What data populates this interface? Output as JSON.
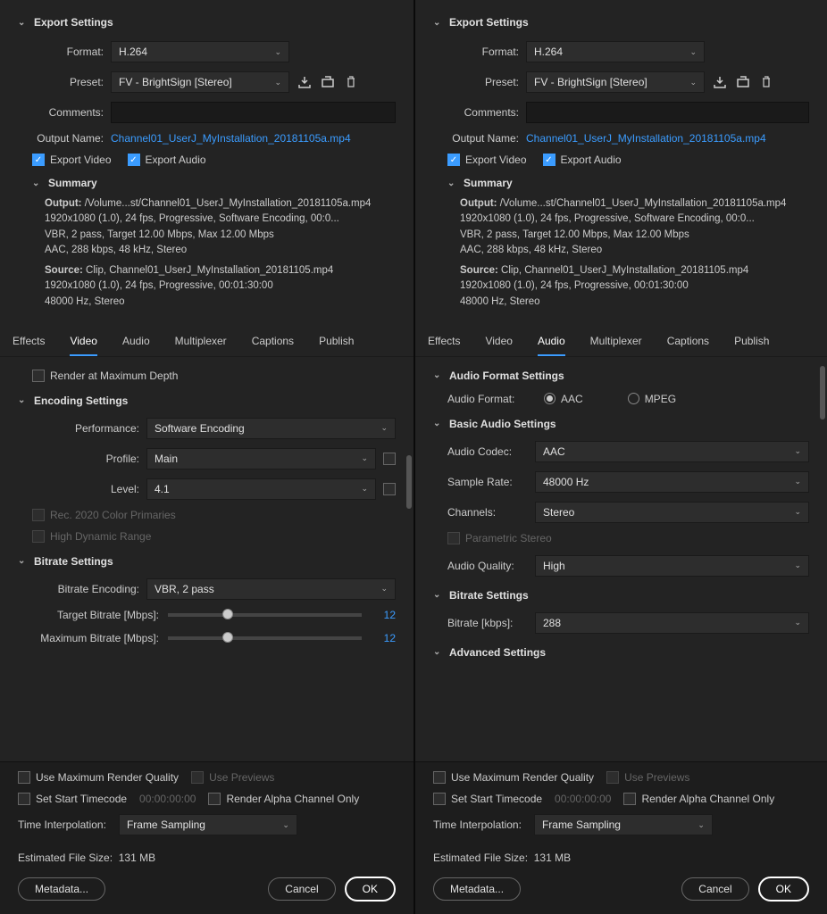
{
  "left": {
    "header": "Export Settings",
    "format_label": "Format:",
    "format_value": "H.264",
    "preset_label": "Preset:",
    "preset_value": "FV - BrightSign [Stereo]",
    "comments_label": "Comments:",
    "output_label": "Output Name:",
    "output_value": "Channel01_UserJ_MyInstallation_20181105a.mp4",
    "export_video": "Export Video",
    "export_audio": "Export Audio",
    "summary_header": "Summary",
    "summary_out_label": "Output:",
    "summary_out_1": "/Volume...st/Channel01_UserJ_MyInstallation_20181105a.mp4",
    "summary_out_2": "1920x1080 (1.0), 24 fps, Progressive, Software Encoding, 00:0...",
    "summary_out_3": "VBR, 2 pass, Target 12.00 Mbps, Max 12.00 Mbps",
    "summary_out_4": "AAC, 288 kbps, 48 kHz, Stereo",
    "summary_src_label": "Source:",
    "summary_src_1": "Clip, Channel01_UserJ_MyInstallation_20181105.mp4",
    "summary_src_2": "1920x1080 (1.0), 24 fps, Progressive, 00:01:30:00",
    "summary_src_3": "48000 Hz, Stereo",
    "tabs": [
      "Effects",
      "Video",
      "Audio",
      "Multiplexer",
      "Captions",
      "Publish"
    ],
    "active_tab": 1,
    "render_max_depth": "Render at Maximum Depth",
    "encoding_header": "Encoding Settings",
    "performance_label": "Performance:",
    "performance_value": "Software Encoding",
    "profile_label": "Profile:",
    "profile_value": "Main",
    "level_label": "Level:",
    "level_value": "4.1",
    "rec2020": "Rec. 2020 Color Primaries",
    "hdr": "High Dynamic Range",
    "bitrate_header": "Bitrate Settings",
    "bitrate_enc_label": "Bitrate Encoding:",
    "bitrate_enc_value": "VBR, 2 pass",
    "target_br_label": "Target Bitrate [Mbps]:",
    "target_br_value": "12",
    "max_br_label": "Maximum Bitrate [Mbps]:",
    "max_br_value": "12"
  },
  "right": {
    "active_tab": 2,
    "afs_header": "Audio Format Settings",
    "af_label": "Audio Format:",
    "af_aac": "AAC",
    "af_mpeg": "MPEG",
    "bas_header": "Basic Audio Settings",
    "codec_label": "Audio Codec:",
    "codec_value": "AAC",
    "sr_label": "Sample Rate:",
    "sr_value": "48000 Hz",
    "ch_label": "Channels:",
    "ch_value": "Stereo",
    "param_stereo": "Parametric Stereo",
    "aq_label": "Audio Quality:",
    "aq_value": "High",
    "br_header": "Bitrate Settings",
    "br_label": "Bitrate [kbps]:",
    "br_value": "288",
    "adv_header": "Advanced Settings"
  },
  "bottom": {
    "umrq": "Use Maximum Render Quality",
    "use_previews": "Use Previews",
    "sst": "Set Start Timecode",
    "tc": "00:00:00:00",
    "raco": "Render Alpha Channel Only",
    "ti_label": "Time Interpolation:",
    "ti_value": "Frame Sampling",
    "est_label": "Estimated File Size:",
    "est_value": "131 MB",
    "metadata": "Metadata...",
    "cancel": "Cancel",
    "ok": "OK"
  }
}
